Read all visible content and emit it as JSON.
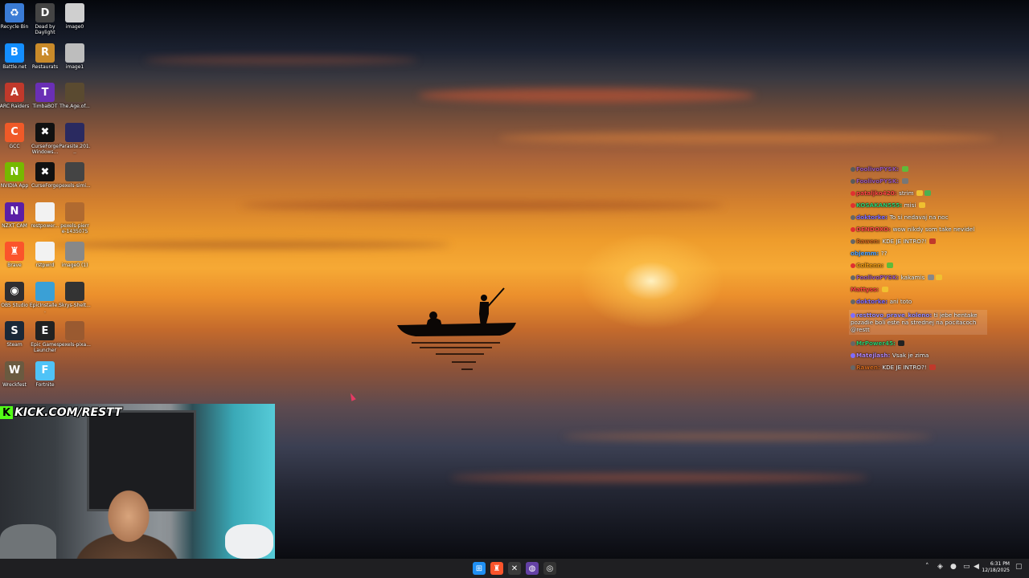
{
  "desktop_icons": [
    {
      "name": "Recycle Bin",
      "icon": "recycle-bin-icon",
      "color": "#3a7bd5",
      "glyph": "♻"
    },
    {
      "name": "Dead by Daylight",
      "icon": "dead-by-daylight-icon",
      "color": "#444",
      "glyph": "D"
    },
    {
      "name": "image0",
      "icon": "image-file-icon",
      "color": "#cfcfcf",
      "glyph": ""
    },
    {
      "name": "Battle.net",
      "icon": "battlenet-icon",
      "color": "#148eff",
      "glyph": "B"
    },
    {
      "name": "Restaurats",
      "icon": "restaurats-icon",
      "color": "#c98a2a",
      "glyph": "R"
    },
    {
      "name": "image1",
      "icon": "image-file-icon",
      "color": "#bdbdbd",
      "glyph": ""
    },
    {
      "name": "ARC Raiders",
      "icon": "arc-raiders-icon",
      "color": "#c0392b",
      "glyph": "A"
    },
    {
      "name": "TimbaBOT",
      "icon": "timbabot-icon",
      "color": "#6a2fb5",
      "glyph": "T"
    },
    {
      "name": "The.Age.of...",
      "icon": "video-file-icon",
      "color": "#5a4a30",
      "glyph": ""
    },
    {
      "name": "GCC",
      "icon": "gcc-icon",
      "color": "#f05a28",
      "glyph": "C"
    },
    {
      "name": "CurseForge Windows...",
      "icon": "curseforge-icon",
      "color": "#111",
      "glyph": "✖"
    },
    {
      "name": "Parasite.201...",
      "icon": "video-file-icon",
      "color": "#2a2a60",
      "glyph": ""
    },
    {
      "name": "NVIDIA App",
      "icon": "nvidia-icon",
      "color": "#76b900",
      "glyph": "N"
    },
    {
      "name": "CurseForge",
      "icon": "curseforge-icon",
      "color": "#111",
      "glyph": "✖"
    },
    {
      "name": "pexels-simi...",
      "icon": "image-file-icon",
      "color": "#444",
      "glyph": ""
    },
    {
      "name": "NZXT CAM",
      "icon": "nzxt-icon",
      "color": "#5b1fa6",
      "glyph": "N"
    },
    {
      "name": "restpower...",
      "icon": "file-icon",
      "color": "#f2f2f2",
      "glyph": ""
    },
    {
      "name": "pexels-pierr e-1435075",
      "icon": "image-file-icon",
      "color": "#b06a30",
      "glyph": ""
    },
    {
      "name": "Brave",
      "icon": "brave-icon",
      "color": "#fb542b",
      "glyph": "♜"
    },
    {
      "name": "rstpwrd",
      "icon": "file-icon",
      "color": "#f2f2f2",
      "glyph": ""
    },
    {
      "name": "image0 (1)",
      "icon": "image-file-icon",
      "color": "#888",
      "glyph": ""
    },
    {
      "name": "OBS Studio",
      "icon": "obs-icon",
      "color": "#302e31",
      "glyph": "◉"
    },
    {
      "name": "EpicInstalle...",
      "icon": "installer-icon",
      "color": "#3aa0d6",
      "glyph": ""
    },
    {
      "name": "Skrys-Shelt...",
      "icon": "image-file-icon",
      "color": "#333",
      "glyph": ""
    },
    {
      "name": "Steam",
      "icon": "steam-icon",
      "color": "#1b2838",
      "glyph": "S"
    },
    {
      "name": "Epic Games Launcher",
      "icon": "epic-games-icon",
      "color": "#222",
      "glyph": "E"
    },
    {
      "name": "pexels-pixa...",
      "icon": "image-file-icon",
      "color": "#9a5a30",
      "glyph": ""
    },
    {
      "name": "Wreckfest",
      "icon": "wreckfest-icon",
      "color": "#6a5a40",
      "glyph": "W"
    },
    {
      "name": "Fortnite",
      "icon": "fortnite-icon",
      "color": "#4fc3f7",
      "glyph": "F"
    }
  ],
  "overlay": {
    "kick_label": "KICK.COM/RESTT",
    "kick_logo": "K"
  },
  "chat": [
    {
      "user": "FoolivoPYSK:",
      "text": "",
      "user_color": "#9b59b6",
      "dot": "#5a5a5a",
      "emotes": [
        "#5fba3a"
      ]
    },
    {
      "user": "FoolivoPYSK:",
      "text": "",
      "user_color": "#9b59b6",
      "dot": "#5a5a5a",
      "emotes": [
        "#777"
      ]
    },
    {
      "user": "pataljko420:",
      "text": "strim",
      "user_color": "#ff4545",
      "dot": "#e03030",
      "emotes": [
        "#f0c030",
        "#4caf50"
      ]
    },
    {
      "user": "KOSAKAN555:",
      "text": "misi",
      "user_color": "#2ecc71",
      "dot": "#e03030",
      "emotes": [
        "#f0c030"
      ]
    },
    {
      "user": "doktorke:",
      "text": "To si nedavaj na noc",
      "user_color": "#7f6cff",
      "dot": "#666",
      "emotes": []
    },
    {
      "user": "DENDOXO:",
      "text": "wow nikdy som take nevidel",
      "user_color": "#ff4a4a",
      "dot": "#e03030",
      "emotes": []
    },
    {
      "user": "Rawen:",
      "text": "KDE JE INTRO?!",
      "user_color": "#d2691e",
      "dot": "#666",
      "emotes": [
        "#c0392b"
      ]
    },
    {
      "user": "objemm:",
      "text": "??",
      "user_color": "#4fa3ff",
      "dot": "",
      "emotes": []
    },
    {
      "user": "Coltenn:",
      "text": "",
      "user_color": "#f39c12",
      "dot": "#e03030",
      "emotes": [
        "#5fba3a"
      ]
    },
    {
      "user": "FoolivoPYSK:",
      "text": "kakamis",
      "user_color": "#9b59b6",
      "dot": "#666",
      "emotes": [
        "#888",
        "#f0c030"
      ]
    },
    {
      "user": "Mattyss:",
      "text": "",
      "user_color": "#ff4545",
      "dot": "",
      "emotes": [
        "#f0c030"
      ]
    },
    {
      "user": "doktorke:",
      "text": "ani toto",
      "user_color": "#7f6cff",
      "dot": "#666",
      "emotes": []
    },
    {
      "user": "resttovo_prave_koleno:",
      "text": "ti jebe hentake pozadie boli este na strednej na pocitacoch @restt",
      "user_color": "#9b8cff",
      "dot": "#7f6cff",
      "emotes": [],
      "highlight": true
    },
    {
      "user": "MrPower45:",
      "text": "",
      "user_color": "#2ecc71",
      "dot": "#666",
      "emotes": [
        "#222"
      ]
    },
    {
      "user": "Matejlash:",
      "text": "Vsak je zima",
      "user_color": "#b085f5",
      "dot": "#7f6cff",
      "emotes": []
    },
    {
      "user": "Rawen:",
      "text": "KDE JE INTRO?!",
      "user_color": "#d2691e",
      "dot": "#666",
      "emotes": [
        "#c0392b"
      ]
    }
  ],
  "taskbar": {
    "apps": [
      {
        "name": "start",
        "icon": "windows-start-icon",
        "color": "#1f8ff3",
        "glyph": "⊞"
      },
      {
        "name": "brave",
        "icon": "brave-icon",
        "color": "#fb542b",
        "glyph": "♜"
      },
      {
        "name": "xbox",
        "icon": "xbox-icon",
        "color": "#3a3a3a",
        "glyph": "✕"
      },
      {
        "name": "twitch",
        "icon": "twitch-icon",
        "color": "#6441a5",
        "glyph": "◍"
      },
      {
        "name": "chatgpt",
        "icon": "chat-app-icon",
        "color": "#333",
        "glyph": "◎"
      }
    ],
    "time": "6:31 PM",
    "date": "12/18/2025"
  }
}
